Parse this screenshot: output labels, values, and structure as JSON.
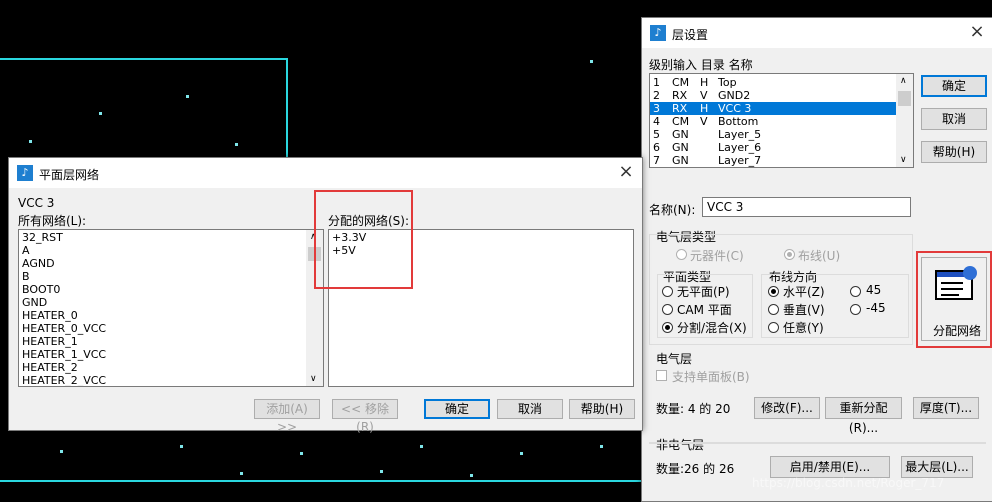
{
  "layer_dialog": {
    "title": "层设置",
    "list_header": "级别输入  目录  名称",
    "layers": [
      {
        "num": "1",
        "type": "CM",
        "dir": "H",
        "name": "Top",
        "selected": false
      },
      {
        "num": "2",
        "type": "RX",
        "dir": "V",
        "name": "GND2",
        "selected": false
      },
      {
        "num": "3",
        "type": "RX",
        "dir": "H",
        "name": "VCC 3",
        "selected": true
      },
      {
        "num": "4",
        "type": "CM",
        "dir": "V",
        "name": "Bottom",
        "selected": false
      },
      {
        "num": "5",
        "type": "GN",
        "dir": "",
        "name": "Layer_5",
        "selected": false
      },
      {
        "num": "6",
        "type": "GN",
        "dir": "",
        "name": "Layer_6",
        "selected": false
      },
      {
        "num": "7",
        "type": "GN",
        "dir": "",
        "name": "Layer_7",
        "selected": false
      }
    ],
    "ok": "确定",
    "cancel": "取消",
    "help": "帮助(H)",
    "name_label": "名称(N):",
    "name_value": "VCC 3",
    "elec_type_label": "电气层类型",
    "component_label": "元器件(C)",
    "routing_label": "布线(U)",
    "plane_type_label": "平面类型",
    "no_plane": "无平面(P)",
    "cam_plane": "CAM 平面",
    "split_mixed": "分割/混合(X)",
    "route_dir_label": "布线方向",
    "horizontal": "水平(Z)",
    "vertical": "垂直(V)",
    "any": "任意(Y)",
    "deg45": "45",
    "degm45": "-45",
    "assign_nets": "分配网络",
    "electrical_layer": "电气层",
    "support_single": "支持单面板(B)",
    "count_label": "数量: 4 的 20",
    "modify": "修改(F)...",
    "reassign": "重新分配(R)...",
    "thickness": "厚度(T)...",
    "non_electrical": "非电气层",
    "count2_label": "数量:26 的 26",
    "enable_disable": "启用/禁用(E)...",
    "max_layers": "最大层(L)..."
  },
  "plane_dialog": {
    "title": "平面层网络",
    "layer_name": "VCC 3",
    "all_nets_label": "所有网络(L):",
    "all_nets": [
      "32_RST",
      "A",
      "AGND",
      "B",
      "BOOT0",
      "GND",
      "HEATER_0",
      "HEATER_0_VCC",
      "HEATER_1",
      "HEATER_1_VCC",
      "HEATER_2",
      "HEATER_2_VCC"
    ],
    "assigned_label": "分配的网络(S):",
    "assigned_nets": [
      "+3.3V",
      "+5V"
    ],
    "add": "添加(A) >>",
    "remove": "<< 移除(R)",
    "ok": "确定",
    "cancel": "取消",
    "help": "帮助(H)"
  },
  "watermark": "https://blog.csdn.net/Roger_717",
  "colors": {
    "canvas": "#000000",
    "trace": "#2ad7df",
    "highlight": "#e23a3a",
    "selection": "#0078d7"
  }
}
